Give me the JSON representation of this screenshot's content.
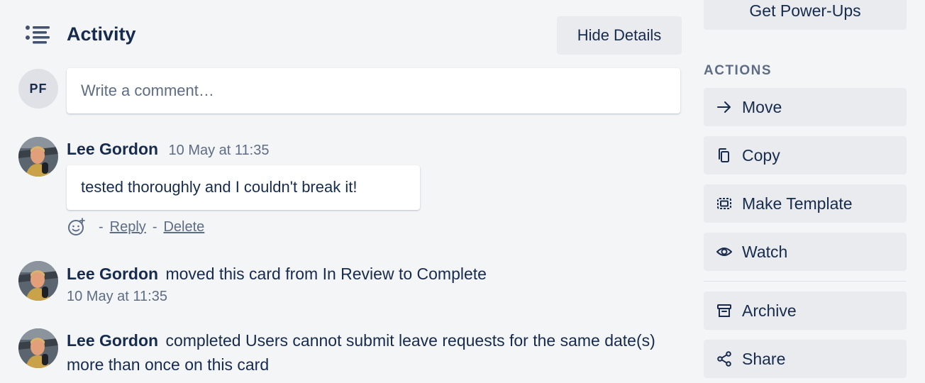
{
  "activity": {
    "title": "Activity",
    "icon": "activity-list-icon",
    "hide_details_label": "Hide Details"
  },
  "composer": {
    "avatar_initials": "PF",
    "placeholder": "Write a comment…"
  },
  "comment": {
    "author": "Lee Gordon",
    "time": "10 May at 11:35",
    "text": "tested thoroughly and I couldn't break it!",
    "reaction_icon": "add-reaction-icon",
    "separator": "-",
    "reply_label": "Reply",
    "delete_label": "Delete"
  },
  "activity_items": [
    {
      "author": "Lee Gordon",
      "text": "moved this card from In Review to Complete",
      "time": "10 May at 11:35"
    },
    {
      "author": "Lee Gordon",
      "text": "completed Users cannot submit leave requests for the same date(s) more than once on this card"
    }
  ],
  "sidebar": {
    "powerups_label": "Get Power-Ups",
    "actions_heading": "ACTIONS",
    "actions": [
      {
        "label": "Move",
        "icon": "arrow-right-icon"
      },
      {
        "label": "Copy",
        "icon": "copy-icon"
      },
      {
        "label": "Make Template",
        "icon": "template-icon"
      },
      {
        "label": "Watch",
        "icon": "eye-icon"
      },
      {
        "label": "Archive",
        "icon": "archive-icon"
      },
      {
        "label": "Share",
        "icon": "share-icon"
      }
    ]
  },
  "colors": {
    "background": "#f4f5f7",
    "text": "#172b4d",
    "subtle_text": "#5e6c84",
    "button_bg": "#e9ebee"
  }
}
